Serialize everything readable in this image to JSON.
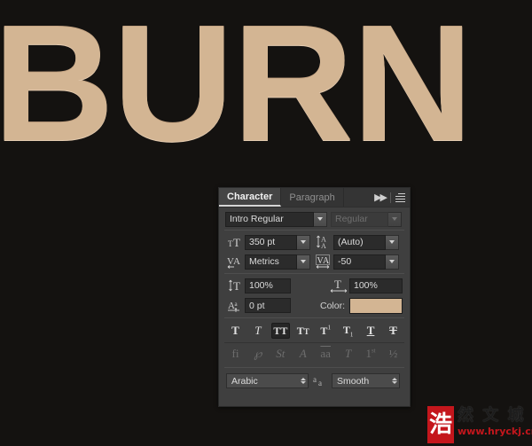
{
  "artwork": {
    "text": "BURN",
    "text_color": "#d3b593",
    "background_color": "#141210"
  },
  "panel": {
    "tabs": [
      {
        "label": "Character",
        "active": true
      },
      {
        "label": "Paragraph",
        "active": false
      }
    ],
    "collapse_icon": "double-chevron-right-icon",
    "menu_icon": "panel-menu-icon",
    "font_family": {
      "value": "Intro  Regular",
      "icon": "font-family-field"
    },
    "font_style": {
      "value": "Regular",
      "disabled": true
    },
    "font_size": {
      "icon": "font-size-icon",
      "value": "350 pt"
    },
    "leading": {
      "icon": "leading-icon",
      "value": "(Auto)"
    },
    "kerning": {
      "icon": "kerning-icon",
      "value": "Metrics"
    },
    "tracking": {
      "icon": "tracking-icon",
      "value": "-50"
    },
    "vertical_scale": {
      "icon": "vertical-scale-icon",
      "value": "100%"
    },
    "horizontal_scale": {
      "icon": "horizontal-scale-icon",
      "value": "100%"
    },
    "baseline_shift": {
      "icon": "baseline-shift-icon",
      "value": "0 pt"
    },
    "color": {
      "label": "Color:",
      "value": "#d3b593"
    },
    "style_buttons": [
      {
        "glyph": "T",
        "name": "faux-bold",
        "state": "off",
        "style": "bold"
      },
      {
        "glyph": "T",
        "name": "faux-italic",
        "state": "off",
        "style": "italic"
      },
      {
        "glyph": "TT",
        "name": "all-caps",
        "state": "on",
        "style": "bold"
      },
      {
        "glyph": "TT",
        "name": "small-caps",
        "state": "off",
        "style": "smallcaps"
      },
      {
        "glyph": "T",
        "name": "superscript",
        "state": "off",
        "style": "super"
      },
      {
        "glyph": "T",
        "name": "subscript",
        "state": "off",
        "style": "sub"
      },
      {
        "glyph": "T",
        "name": "underline",
        "state": "off",
        "style": "underline"
      },
      {
        "glyph": "T",
        "name": "strikethrough",
        "state": "off",
        "style": "strike"
      }
    ],
    "opentype_buttons": [
      {
        "glyph": "fi",
        "name": "standard-ligatures"
      },
      {
        "glyph": "℘",
        "name": "contextual-alternates"
      },
      {
        "glyph": "St",
        "name": "discretionary-ligatures"
      },
      {
        "glyph": "A",
        "name": "swash"
      },
      {
        "glyph": "aa",
        "name": "oldstyle"
      },
      {
        "glyph": "T",
        "name": "titling-alternates"
      },
      {
        "glyph": "1st",
        "name": "ordinals"
      },
      {
        "glyph": "½",
        "name": "fractions"
      }
    ],
    "language": {
      "value": "Arabic"
    },
    "antialias_icon": "anti-alias-icon",
    "antialias": {
      "value": "Smooth"
    }
  },
  "watermark": {
    "seal_char": "浩",
    "chinese": "然 文 城",
    "url": "www.hryckj.cn"
  }
}
